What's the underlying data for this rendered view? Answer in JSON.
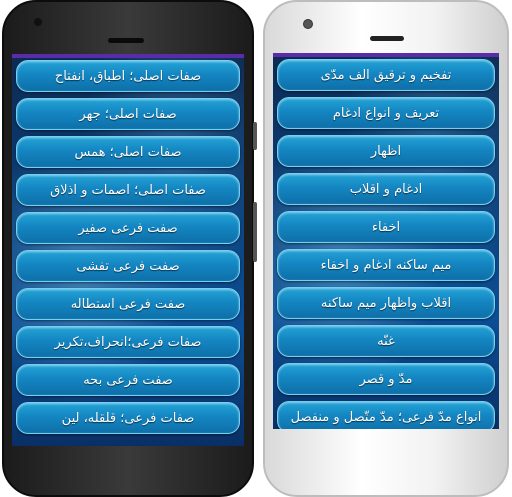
{
  "left_phone": {
    "items": [
      {
        "label": "صفات اصلی؛ اطباق، انفتاح"
      },
      {
        "label": "صفات اصلی؛ جهر"
      },
      {
        "label": "صفات اصلی؛ همس"
      },
      {
        "label": "صفات اصلی؛ اصمات و اذلاق"
      },
      {
        "label": "صفت فرعی صفیر"
      },
      {
        "label": "صفت فرعی تفشی"
      },
      {
        "label": "صفت فرعی استطاله"
      },
      {
        "label": "صفات فرعی؛انحراف،تکریر"
      },
      {
        "label": "صفت فرعی بحه"
      },
      {
        "label": "صفات فرعی؛ قلقله، لین"
      }
    ]
  },
  "right_phone": {
    "items": [
      {
        "label": "تفخیم و ترقیق الف مدّی"
      },
      {
        "label": "تعریف و انواع ادغام"
      },
      {
        "label": "اظهار"
      },
      {
        "label": "ادغام و اقلاب"
      },
      {
        "label": "اخفاء"
      },
      {
        "label": "میم ساکنه ادغام و اخفاء"
      },
      {
        "label": "اقلاب واظهار میم ساکنه"
      },
      {
        "label": "غنّه"
      },
      {
        "label": "مدّ و قصر"
      },
      {
        "label": "انواع مدّ فرعی؛ مدّ متّصل و منفصل"
      }
    ]
  },
  "colors": {
    "button_fill": "#1486c2",
    "button_border": "#6fd2f5",
    "screen_bg": "#0a3f7a",
    "top_bar": "#5a2ca8"
  }
}
